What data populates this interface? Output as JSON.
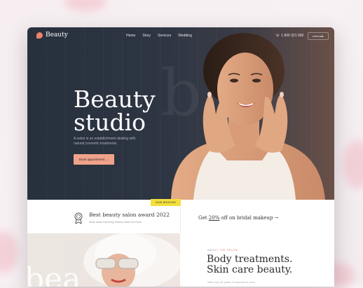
{
  "colors": {
    "accent": "#f0a38a",
    "dark": "#27303d",
    "tag": "#f3e03d",
    "logo": "#e9836a"
  },
  "nav": {
    "logo": "Beauty",
    "links": [
      "Home",
      "Story",
      "Services",
      "Wedding"
    ],
    "phone": "1 800 321 000",
    "talk": "Let's talk"
  },
  "hero": {
    "title_line1": "Beauty",
    "title_line2": "studio",
    "bg_word": "b",
    "subtitle": "A salon is an establishment dealing with natural cosmetic treatments",
    "book_button": "Book appointment →"
  },
  "tag": "NOW BOOKING",
  "award": {
    "title": "Best beauty salon award 2022",
    "subtitle": "Multi-award winning beauty salon services"
  },
  "promo": {
    "before": "Get ",
    "highlight": "20%",
    "after": " off on bridal makeup →"
  },
  "lower": {
    "bg_word": "bea",
    "about_prefix": "ABOUT ",
    "about_highlight": "THE SALON",
    "title_line1": "Body treatments.",
    "title_line2": "Skin care beauty.",
    "text": "With over 25 years of experience we'd"
  }
}
